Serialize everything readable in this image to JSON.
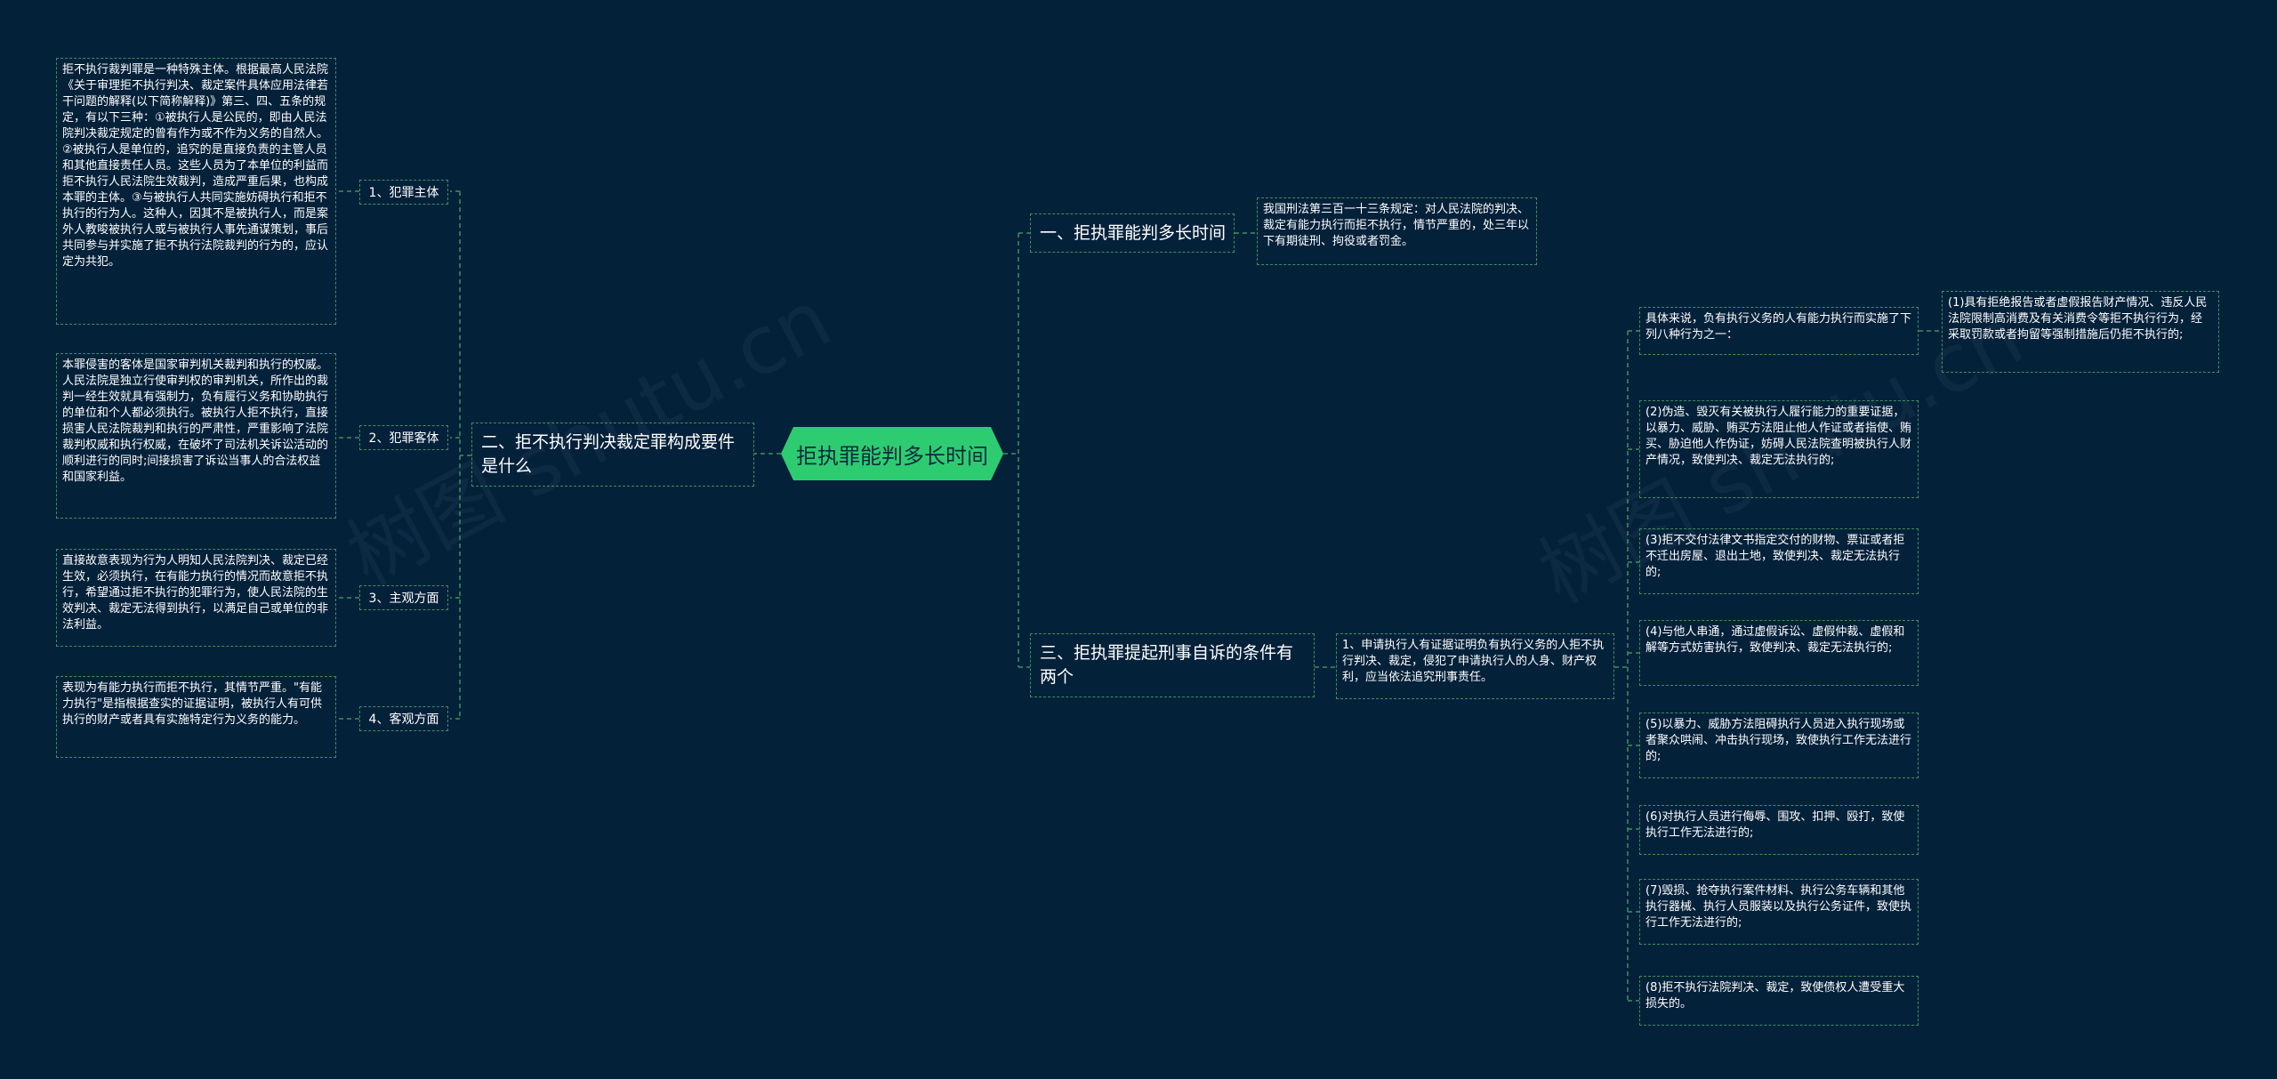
{
  "root": {
    "title": "拒执罪能判多长时间"
  },
  "branches": {
    "b1": {
      "title": "一、拒执罪能判多长时间",
      "note": "我国刑法第三百一十三条规定：对人民法院的判决、裁定有能力执行而拒不执行，情节严重的，处三年以下有期徒刑、拘役或者罚金。"
    },
    "b2": {
      "title": "二、拒不执行判决裁定罪构成要件是什么"
    },
    "b3": {
      "title": "三、拒执罪提起刑事自诉的条件有两个"
    }
  },
  "elements": {
    "e1": {
      "label": "1、犯罪主体",
      "text": "拒不执行裁判罪是一种特殊主体。根据最高人民法院《关于审理拒不执行判决、裁定案件具体应用法律若干问题的解释(以下简称解释)》第三、四、五条的规定，有以下三种：①被执行人是公民的，即由人民法院判决裁定规定的曾有作为或不作为义务的自然人。②被执行人是单位的，追究的是直接负责的主管人员和其他直接责任人员。这些人员为了本单位的利益而拒不执行人民法院生效裁判，造成严重后果，也构成本罪的主体。③与被执行人共同实施妨碍执行和拒不执行的行为人。这种人，因其不是被执行人，而是案外人教唆被执行人或与被执行人事先通谋策划，事后共同参与并实施了拒不执行法院裁判的行为的，应认定为共犯。"
    },
    "e2": {
      "label": "2、犯罪客体",
      "text": "本罪侵害的客体是国家审判机关裁判和执行的权威。人民法院是独立行使审判权的审判机关，所作出的裁判一经生效就具有强制力，负有履行义务和协助执行的单位和个人都必须执行。被执行人拒不执行，直接损害人民法院裁判和执行的严肃性，严重影响了法院裁判权威和执行权威，在破坏了司法机关诉讼活动的顺利进行的同时;间接损害了诉讼当事人的合法权益和国家利益。"
    },
    "e3": {
      "label": "3、主观方面",
      "text": "直接故意表现为行为人明知人民法院判决、裁定已经生效，必须执行，在有能力执行的情况而故意拒不执行，希望通过拒不执行的犯罪行为，使人民法院的生效判决、裁定无法得到执行，以满足自己或单位的非法利益。"
    },
    "e4": {
      "label": "4、客观方面",
      "text": "表现为有能力执行而拒不执行，其情节严重。\"有能力执行\"是指根据查实的证据证明，被执行人有可供执行的财产或者具有实施特定行为义务的能力。"
    }
  },
  "conditions": {
    "c1": "1、申请执行人有证据证明负有执行义务的人拒不执行判决、裁定，侵犯了申请执行人的人身、财产权利，应当依法追究刑事责任。",
    "intro": "具体来说，负有执行义务的人有能力执行而实施了下列八种行为之一：",
    "items": [
      "(1)具有拒绝报告或者虚假报告财产情况、违反人民法院限制高消费及有关消费令等拒不执行行为，经采取罚款或者拘留等强制措施后仍拒不执行的;",
      "(2)伪造、毁灭有关被执行人履行能力的重要证据，以暴力、威胁、贿买方法阻止他人作证或者指使、贿买、胁迫他人作伪证，妨碍人民法院查明被执行人财产情况，致使判决、裁定无法执行的;",
      "(3)拒不交付法律文书指定交付的财物、票证或者拒不迁出房屋、退出土地，致使判决、裁定无法执行的;",
      "(4)与他人串通，通过虚假诉讼、虚假仲裁、虚假和解等方式妨害执行，致使判决、裁定无法执行的;",
      "(5)以暴力、威胁方法阻碍执行人员进入执行现场或者聚众哄闹、冲击执行现场，致使执行工作无法进行的;",
      "(6)对执行人员进行侮辱、围攻、扣押、殴打，致使执行工作无法进行的;",
      "(7)毁损、抢夺执行案件材料、执行公务车辆和其他执行器械、执行人员服装以及执行公务证件，致使执行工作无法进行的;",
      "(8)拒不执行法院判决、裁定，致使债权人遭受重大损失的。"
    ]
  },
  "colors": {
    "background": "#04213a",
    "root": "#2ecc71",
    "line": "#3f8f5c",
    "text": "#ffffff"
  }
}
